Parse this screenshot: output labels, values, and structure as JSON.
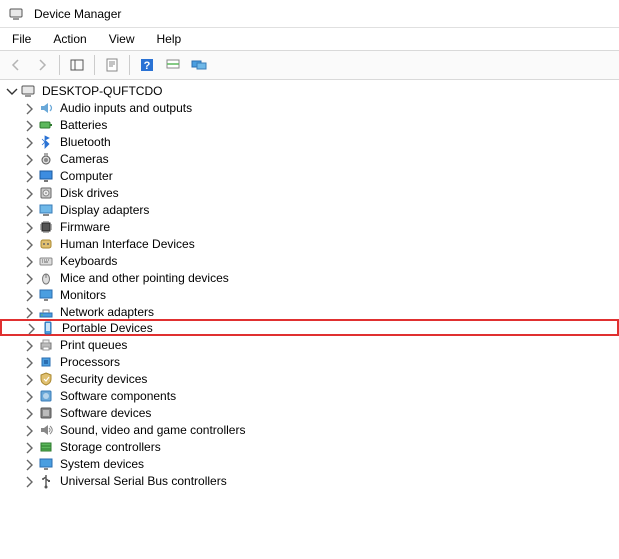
{
  "window": {
    "title": "Device Manager"
  },
  "menu": {
    "items": [
      "File",
      "Action",
      "View",
      "Help"
    ]
  },
  "tree": {
    "root_expanded": true,
    "computer_name": "DESKTOP-QUFTCDO",
    "categories": [
      {
        "label": "Audio inputs and outputs",
        "icon": "audio"
      },
      {
        "label": "Batteries",
        "icon": "battery"
      },
      {
        "label": "Bluetooth",
        "icon": "bluetooth"
      },
      {
        "label": "Cameras",
        "icon": "camera"
      },
      {
        "label": "Computer",
        "icon": "monitor"
      },
      {
        "label": "Disk drives",
        "icon": "disk"
      },
      {
        "label": "Display adapters",
        "icon": "display"
      },
      {
        "label": "Firmware",
        "icon": "chip"
      },
      {
        "label": "Human Interface Devices",
        "icon": "hid"
      },
      {
        "label": "Keyboards",
        "icon": "keyboard"
      },
      {
        "label": "Mice and other pointing devices",
        "icon": "mouse"
      },
      {
        "label": "Monitors",
        "icon": "monitor2"
      },
      {
        "label": "Network adapters",
        "icon": "network"
      },
      {
        "label": "Portable Devices",
        "icon": "portable",
        "highlighted": true
      },
      {
        "label": "Print queues",
        "icon": "printer"
      },
      {
        "label": "Processors",
        "icon": "cpu"
      },
      {
        "label": "Security devices",
        "icon": "security"
      },
      {
        "label": "Software components",
        "icon": "software"
      },
      {
        "label": "Software devices",
        "icon": "software2"
      },
      {
        "label": "Sound, video and game controllers",
        "icon": "sound"
      },
      {
        "label": "Storage controllers",
        "icon": "storage"
      },
      {
        "label": "System devices",
        "icon": "system"
      },
      {
        "label": "Universal Serial Bus controllers",
        "icon": "usb"
      }
    ]
  }
}
